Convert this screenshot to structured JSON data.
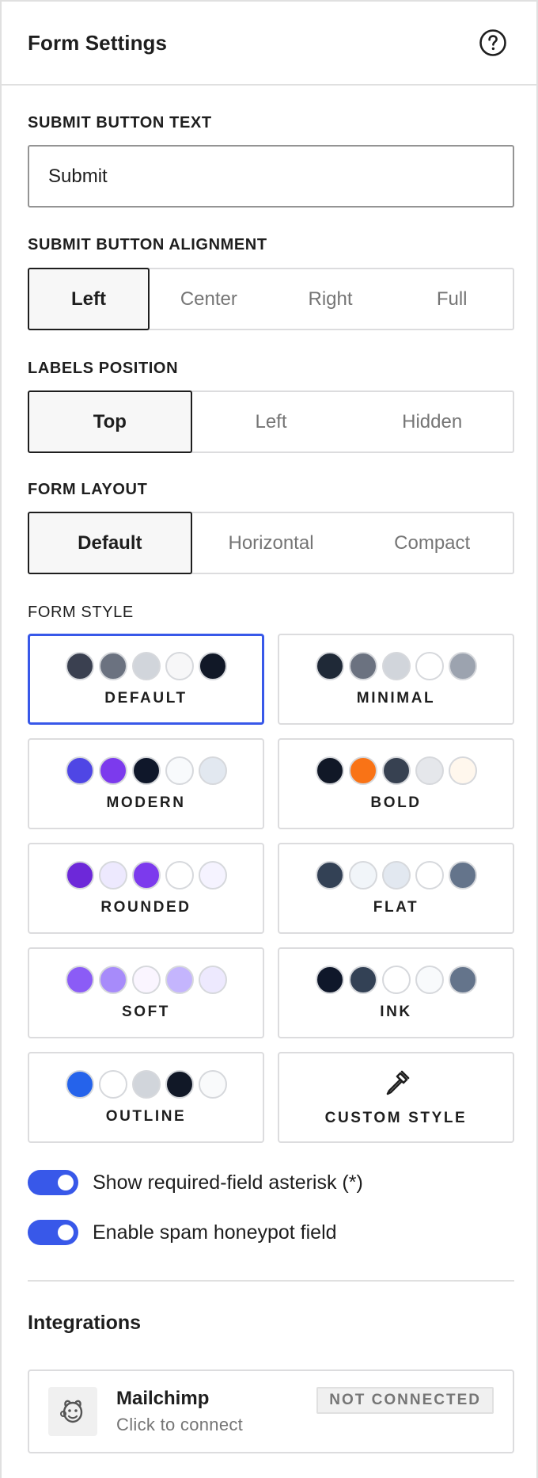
{
  "header": {
    "title": "Form Settings",
    "help_icon": "help-circle-icon"
  },
  "submit_text": {
    "label": "SUBMIT BUTTON TEXT",
    "value": "Submit"
  },
  "alignment": {
    "label": "SUBMIT BUTTON ALIGNMENT",
    "options": [
      "Left",
      "Center",
      "Right",
      "Full"
    ],
    "selected": "Left"
  },
  "labels_position": {
    "label": "LABELS POSITION",
    "options": [
      "Top",
      "Left",
      "Hidden"
    ],
    "selected": "Top"
  },
  "form_layout": {
    "label": "FORM LAYOUT",
    "options": [
      "Default",
      "Horizontal",
      "Compact"
    ],
    "selected": "Default"
  },
  "form_style": {
    "label": "FORM STYLE",
    "selected": "DEFAULT",
    "accent": "#3858e9",
    "styles": [
      {
        "name": "DEFAULT",
        "swatches": [
          "#3a4050",
          "#6b7280",
          "#d1d5db",
          "#f7f7f8",
          "#111827"
        ]
      },
      {
        "name": "MINIMAL",
        "swatches": [
          "#1f2937",
          "#6b7280",
          "#d1d5db",
          "#ffffff",
          "#9ca3af"
        ]
      },
      {
        "name": "MODERN",
        "swatches": [
          "#4f46e5",
          "#7c3aed",
          "#0f172a",
          "#f8fafc",
          "#e2e8f0"
        ]
      },
      {
        "name": "BOLD",
        "swatches": [
          "#111827",
          "#f97316",
          "#374151",
          "#e5e7eb",
          "#fff7ed"
        ]
      },
      {
        "name": "ROUNDED",
        "swatches": [
          "#6d28d9",
          "#ede9fe",
          "#7c3aed",
          "#ffffff",
          "#f5f3ff"
        ]
      },
      {
        "name": "FLAT",
        "swatches": [
          "#334155",
          "#f1f5f9",
          "#e2e8f0",
          "#ffffff",
          "#64748b"
        ]
      },
      {
        "name": "SOFT",
        "swatches": [
          "#8b5cf6",
          "#a78bfa",
          "#faf5ff",
          "#c4b5fd",
          "#ede9fe"
        ]
      },
      {
        "name": "INK",
        "swatches": [
          "#0f172a",
          "#334155",
          "#ffffff",
          "#f8fafc",
          "#64748b"
        ]
      },
      {
        "name": "OUTLINE",
        "swatches": [
          "#2563eb",
          "#ffffff",
          "#d1d5db",
          "#111827",
          "#f9fafb"
        ]
      }
    ],
    "custom": {
      "name": "CUSTOM STYLE",
      "icon": "eyedropper-icon"
    }
  },
  "toggles": [
    {
      "label": "Show required-field asterisk (*)",
      "on": true
    },
    {
      "label": "Enable spam honeypot field",
      "on": true
    }
  ],
  "integrations": {
    "heading": "Integrations",
    "items": [
      {
        "name": "Mailchimp",
        "subtitle": "Click to connect",
        "status": "NOT CONNECTED",
        "icon": "mailchimp-icon"
      }
    ]
  }
}
